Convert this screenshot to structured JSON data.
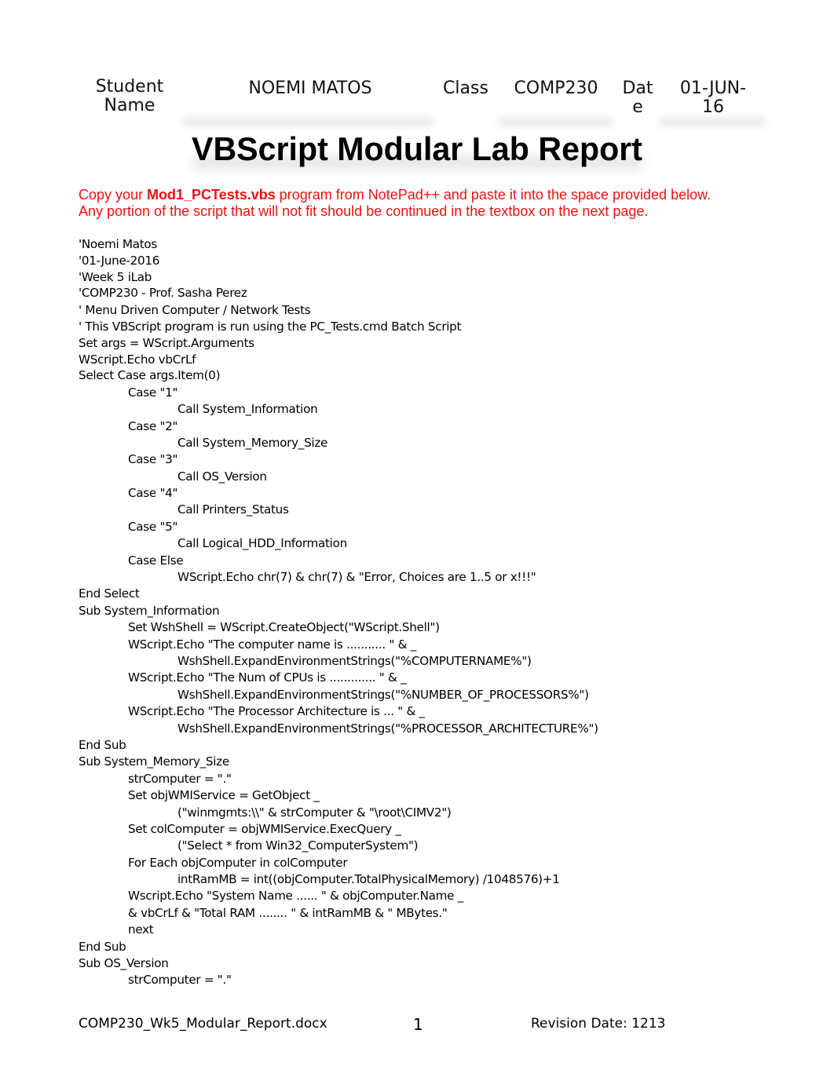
{
  "header": {
    "student_label_line1": "Student",
    "student_label_line2": "Name",
    "student_name": "NOEMI MATOS",
    "class_label": "Class",
    "class_value": "COMP230",
    "date_label_line1": "Dat",
    "date_label_line2": "e",
    "date_value_line1": "01-JUN-",
    "date_value_line2": "16"
  },
  "title": "VBScript Modular Lab Report",
  "instructions": {
    "line1_prefix": "Copy your ",
    "line1_bold": "Mod1_PCTests.vbs",
    "line1_suffix": " program from NotePad++ and paste it into the space provided below.",
    "line2": "Any portion of the script that will not fit should be continued in the textbox on the next page.",
    "color": "#ee1111"
  },
  "code_lines": [
    "'Noemi Matos",
    "'01-June-2016",
    "'Week 5 iLab",
    "'COMP230 - Prof. Sasha Perez",
    "' Menu Driven Computer / Network Tests",
    "' This VBScript program is run using the PC_Tests.cmd Batch Script",
    "Set args = WScript.Arguments",
    "WScript.Echo vbCrLf",
    "Select Case args.Item(0)",
    "Case \"1\"",
    "Call System_Information",
    "Case \"2\"",
    "Call System_Memory_Size",
    "Case \"3\"",
    "Call OS_Version",
    "Case \"4\"",
    "Call Printers_Status",
    "Case \"5\"",
    "Call Logical_HDD_Information",
    "Case Else",
    "WScript.Echo chr(7) & chr(7) & \"Error, Choices are 1..5 or x!!!\"",
    "End Select",
    "Sub System_Information",
    "Set WshShell = WScript.CreateObject(\"WScript.Shell\")",
    "WScript.Echo \"The computer name is ........... \" & _",
    "WshShell.ExpandEnvironmentStrings(\"%COMPUTERNAME%\")",
    "WScript.Echo \"The Num of CPUs is ............. \" & _",
    "WshShell.ExpandEnvironmentStrings(\"%NUMBER_OF_PROCESSORS%\")",
    "WScript.Echo \"The Processor Architecture is ... \" & _",
    "WshShell.ExpandEnvironmentStrings(\"%PROCESSOR_ARCHITECTURE%\")",
    "End Sub",
    "Sub System_Memory_Size",
    "strComputer = \".\"",
    "Set objWMIService = GetObject _",
    "(\"winmgmts:\\\\\" & strComputer & \"\\root\\CIMV2\")",
    "Set colComputer = objWMIService.ExecQuery _",
    "(\"Select * from Win32_ComputerSystem\")",
    "For Each objComputer in colComputer",
    "intRamMB = int((objComputer.TotalPhysicalMemory) /1048576)+1",
    "Wscript.Echo \"System Name ...... \" & objComputer.Name _",
    "& vbCrLf & \"Total RAM ........ \" & intRamMB & \" MBytes.\"",
    "next",
    "End Sub",
    "Sub OS_Version",
    "strComputer = \".\""
  ],
  "footer": {
    "filename": "COMP230_Wk5_Modular_Report.docx",
    "page_number": "1",
    "revision": "Revision Date: 1213"
  }
}
